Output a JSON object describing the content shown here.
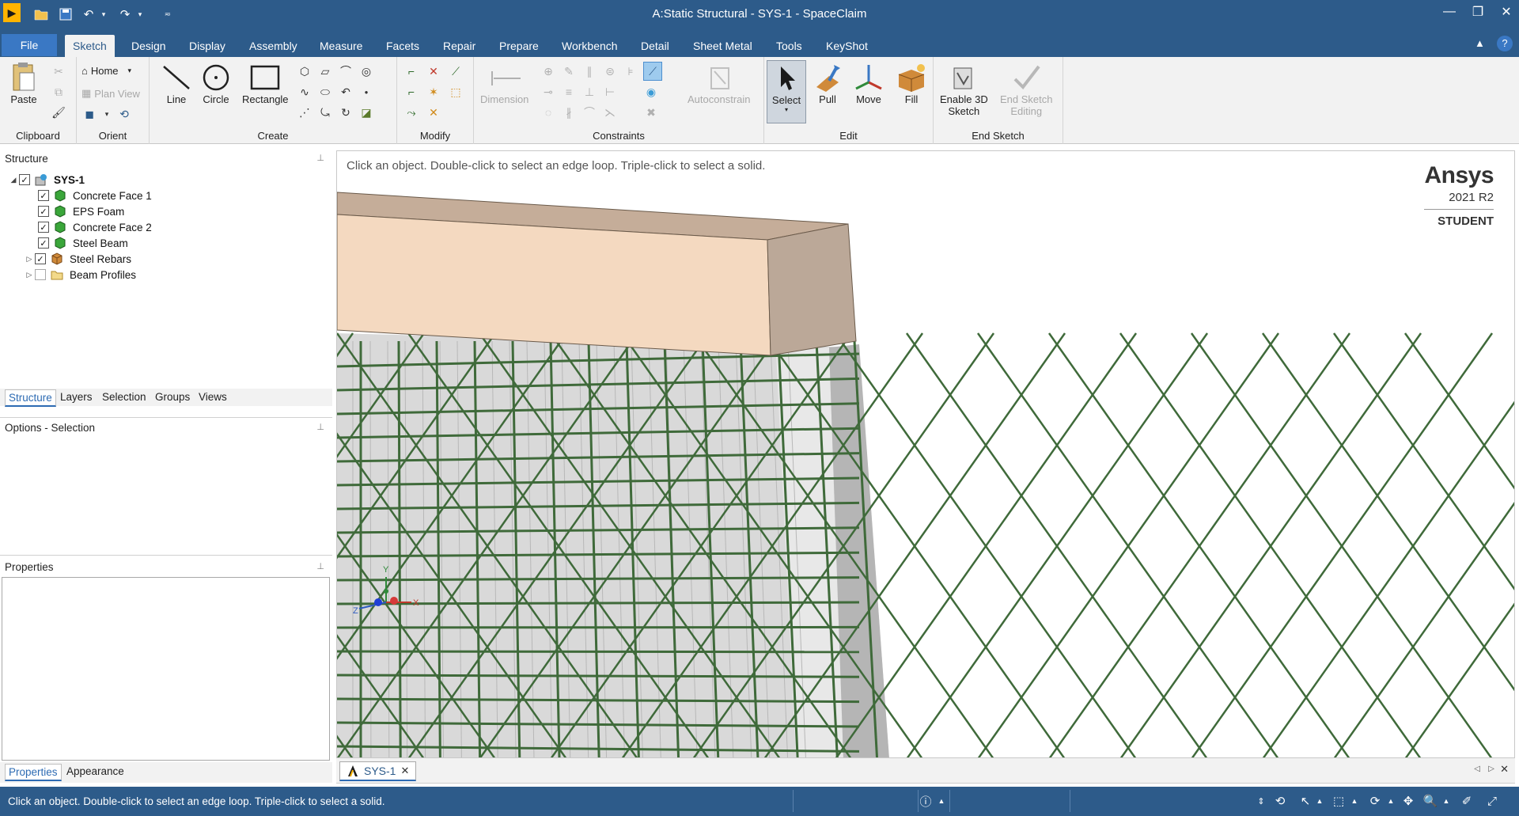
{
  "window": {
    "title": "A:Static Structural - SYS-1 - SpaceClaim",
    "logo_glyph": "▶"
  },
  "tabs": [
    {
      "label": "File"
    },
    {
      "label": "Sketch"
    },
    {
      "label": "Design"
    },
    {
      "label": "Display"
    },
    {
      "label": "Assembly"
    },
    {
      "label": "Measure"
    },
    {
      "label": "Facets"
    },
    {
      "label": "Repair"
    },
    {
      "label": "Prepare"
    },
    {
      "label": "Workbench"
    },
    {
      "label": "Detail"
    },
    {
      "label": "Sheet Metal"
    },
    {
      "label": "Tools"
    },
    {
      "label": "KeyShot"
    }
  ],
  "ribbon": {
    "clipboard": {
      "label": "Clipboard",
      "paste": "Paste"
    },
    "orient": {
      "label": "Orient",
      "home": "Home",
      "plan_view": "Plan View"
    },
    "create": {
      "label": "Create",
      "line": "Line",
      "circle": "Circle",
      "rectangle": "Rectangle"
    },
    "modify": {
      "label": "Modify"
    },
    "constraints": {
      "label": "Constraints",
      "dimension": "Dimension",
      "autoconstrain": "Autoconstrain"
    },
    "edit": {
      "label": "Edit",
      "select": "Select",
      "pull": "Pull",
      "move": "Move",
      "fill": "Fill"
    },
    "end_sketch": {
      "label": "End Sketch",
      "enable_3d_line1": "Enable 3D",
      "enable_3d_line2": "Sketch",
      "end_editing_line1": "End Sketch",
      "end_editing_line2": "Editing"
    }
  },
  "structure": {
    "title": "Structure",
    "root": "SYS-1",
    "items": [
      {
        "label": "Concrete Face 1"
      },
      {
        "label": "EPS Foam"
      },
      {
        "label": "Concrete Face 2"
      },
      {
        "label": "Steel Beam"
      },
      {
        "label": "Steel Rebars"
      },
      {
        "label": "Beam Profiles"
      }
    ],
    "tabs": [
      "Structure",
      "Layers",
      "Selection",
      "Groups",
      "Views"
    ]
  },
  "options": {
    "title": "Options - Selection"
  },
  "properties": {
    "title": "Properties",
    "tabs": [
      "Properties",
      "Appearance"
    ]
  },
  "viewport": {
    "hint": "Click an object. Double-click to select an edge loop. Triple-click to select a solid.",
    "brand_name": "Ansys",
    "brand_version": "2021 R2",
    "brand_edition": "STUDENT",
    "axes": {
      "x": "X",
      "y": "Y",
      "z": "Z"
    },
    "colors": {
      "concrete_top": "#c5ad99",
      "concrete_front": "#f4d9c0",
      "concrete_side": "#bba898",
      "panel": "#d9d9d9",
      "rebar": "#3f6a3a"
    }
  },
  "doc_tab": {
    "label": "SYS-1"
  },
  "status": {
    "text": "Click an object. Double-click to select an edge loop. Triple-click to select a solid."
  }
}
